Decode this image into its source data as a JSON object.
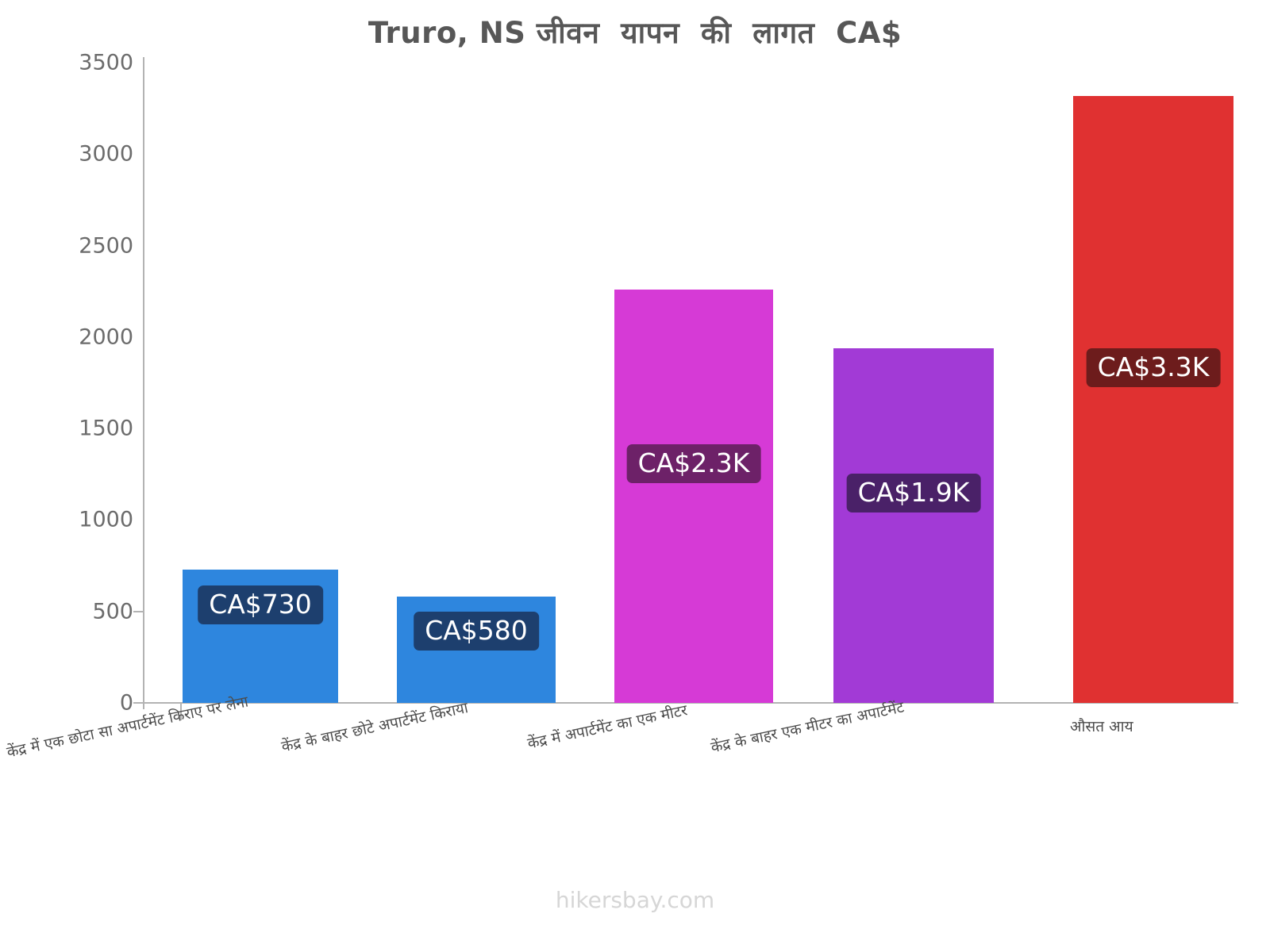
{
  "chart_data": {
    "type": "bar",
    "title": "Truro, NS जीवन  यापन  की  लागत  CA$",
    "xlabel": "",
    "ylabel": "",
    "ylim": [
      0,
      3500
    ],
    "ytick_step": 500,
    "grid": false,
    "legend": false,
    "currency": "CA$",
    "categories": [
      "केंद्र में एक छोटा सा अपार्टमेंट किराए पर लेना",
      "केंद्र के बाहर छोटे अपार्टमेंट किराया",
      "केंद्र में अपार्टमेंट का एक मीटर",
      "केंद्र के बाहर एक मीटर का अपार्टमेंट",
      "औसत आय"
    ],
    "values": [
      730,
      580,
      2260,
      1940,
      3320
    ],
    "value_labels": [
      "CA$730",
      "CA$580",
      "CA$2.3K",
      "CA$1.9K",
      "CA$3.3K"
    ],
    "ticks": [
      "0",
      "500",
      "1000",
      "1500",
      "2000",
      "2500",
      "3000",
      "3500"
    ],
    "tick_values": [
      0,
      500,
      1000,
      1500,
      2000,
      2500,
      3000,
      3500
    ],
    "bar_colors": [
      "#2e86de",
      "#2e86de",
      "#d63ad6",
      "#a23ad6",
      "#e03131"
    ],
    "label_bg_colors": [
      "#1d3f6e",
      "#1d3f6e",
      "#6d2168",
      "#4a2168",
      "#6d1c1c"
    ],
    "label_text_color": "#ffffff"
  },
  "axis": {
    "line_color": "#b3b3b3",
    "tick_text_color": "#6b6b6b"
  },
  "footer": {
    "credit": "hikersbay.com"
  }
}
